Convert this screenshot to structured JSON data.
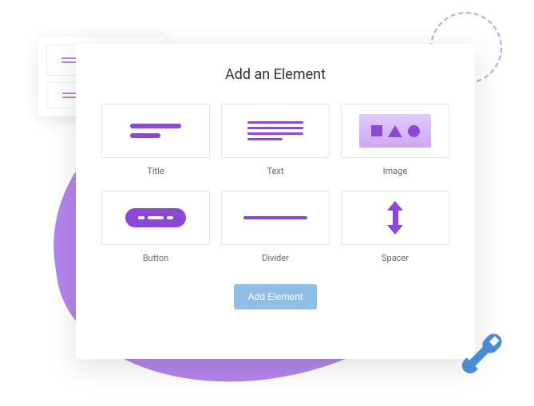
{
  "panel": {
    "title": "Add an Element",
    "add_button": "Add Element"
  },
  "elements": [
    {
      "label": "Title"
    },
    {
      "label": "Text"
    },
    {
      "label": "Image"
    },
    {
      "label": "Button"
    },
    {
      "label": "Divider"
    },
    {
      "label": "Spacer"
    }
  ],
  "colors": {
    "accent": "#8c47d6",
    "blob": "#b385eb",
    "button": "#8fbde6"
  }
}
